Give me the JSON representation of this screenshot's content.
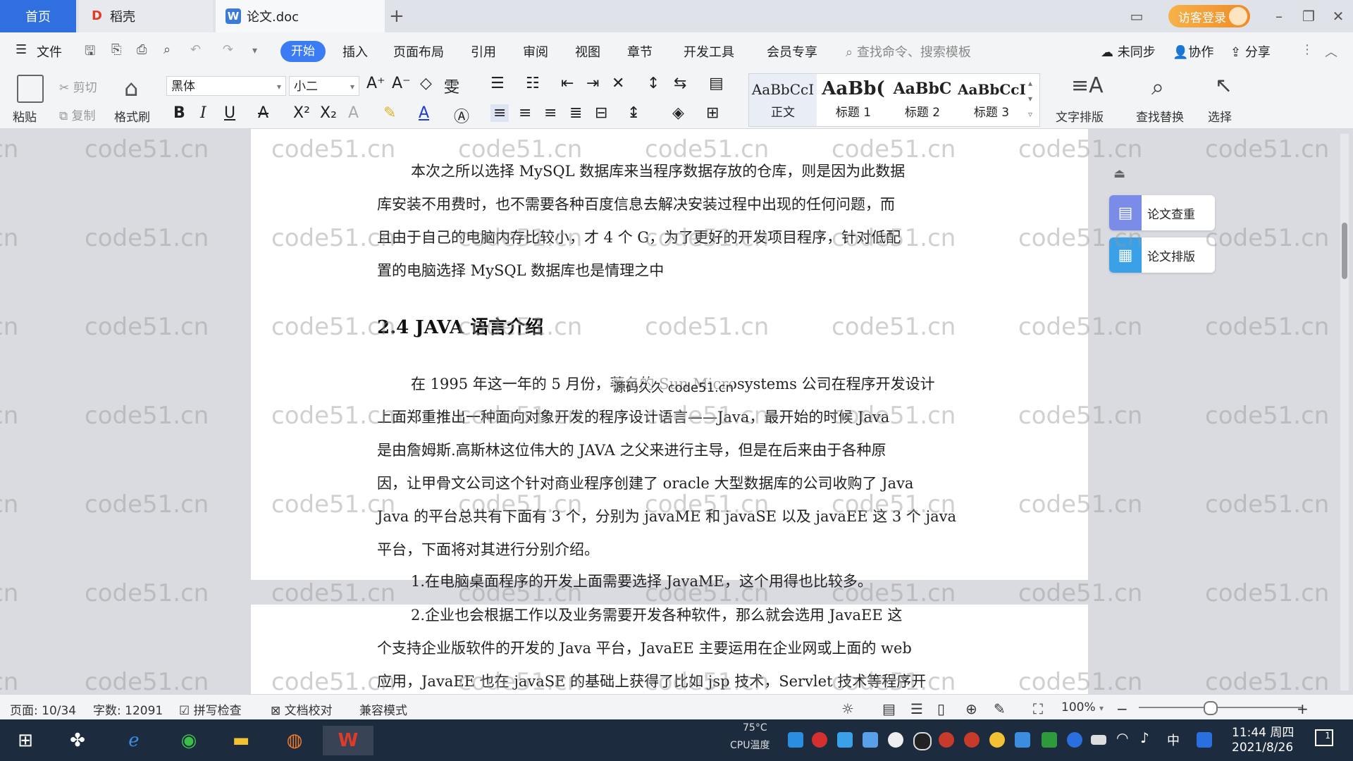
{
  "tabs": {
    "home": "首页",
    "daoke": "稻壳",
    "doc": "论文.doc",
    "new": "+"
  },
  "titlebar": {
    "login": "访客登录"
  },
  "menu": {
    "file": "文件",
    "items": [
      "开始",
      "插入",
      "页面布局",
      "引用",
      "审阅",
      "视图",
      "章节",
      "开发工具",
      "会员专享"
    ],
    "search_placeholder": "查找命令、搜索模板",
    "sync": "未同步",
    "collab": "协作",
    "share": "分享"
  },
  "ribbon": {
    "paste": "粘贴",
    "cut": "剪切",
    "copy": "复制",
    "format_painter": "格式刷",
    "font_name": "黑体",
    "font_size": "小二",
    "styles": [
      {
        "sample": "AaBbCcI",
        "name": "正文"
      },
      {
        "sample": "AaBb(",
        "name": "标题 1"
      },
      {
        "sample": "AaBbC",
        "name": "标题 2"
      },
      {
        "sample": "AaBbCcI",
        "name": "标题 3"
      }
    ],
    "text_layout": "文字排版",
    "find_replace": "查找替换",
    "select": "选择"
  },
  "document": {
    "para1_lines": [
      "本次之所以选择 MySQL 数据库来当程序数据存放的仓库，则是因为此数据",
      "库安装不用费时，也不需要各种百度信息去解决安装过程中出现的任何问题，而",
      "且由于自己的电脑内存比较小，才 4 个 G，为了更好的开发项目程序，针对低配",
      "置的电脑选择 MySQL 数据库也是情理之中"
    ],
    "heading": "2.4 JAVA 语言介绍",
    "para2_lines": [
      "在 1995 年这一年的 5 月份，著名的 Sun Microsystems 公司在程序开发设计",
      "上面郑重推出一种面向对象开发的程序设计语言——Java，最开始的时候 Java",
      "是由詹姆斯.高斯林这位伟大的 JAVA 之父来进行主导，但是在后来由于各种原",
      "因，让甲骨文公司这个针对商业程序创建了 oracle 大型数据库的公司收购了 Java",
      "Java 的平台总共有下面有 3 个，分别为 javaME 和 javaSE 以及 javaEE 这 3 个 java",
      "平台，下面将对其进行分别介绍。"
    ],
    "para3": "1.在电脑桌面程序的开发上面需要选择 JavaME，这个用得也比较多。",
    "overlay": "源码久久 code51.cn",
    "page2_lines": [
      "2.企业也会根据工作以及业务需要开发各种软件，那么就会选用 JavaEE 这",
      "个支持企业版软件的开发的 Java 平台，JavaEE 主要运用在企业网或上面的 web",
      "应用，JavaEE 也在 javaSE 的基础上获得了比如 jsp 技术，Servlet 技术等程序开"
    ]
  },
  "side_panel": {
    "check": "论文查重",
    "layout": "论文排版"
  },
  "watermark": "code51.cn",
  "statusbar": {
    "page": "页面: 10/34",
    "words": "字数: 12091",
    "spell": "拼写检查",
    "proof": "文档校对",
    "compat": "兼容模式",
    "zoom": "100%"
  },
  "taskbar": {
    "cpu_temp": "75°C",
    "cpu_label": "CPU温度",
    "time": "11:44 周四",
    "date": "2021/8/26",
    "ime": "中",
    "notif_count": "1"
  },
  "colors": {
    "accent": "#3b7cf5",
    "login": "#f08a24",
    "taskbar": "#1d2b3f",
    "side_check": "#7a8ce8",
    "side_layout": "#3aa0e8"
  }
}
